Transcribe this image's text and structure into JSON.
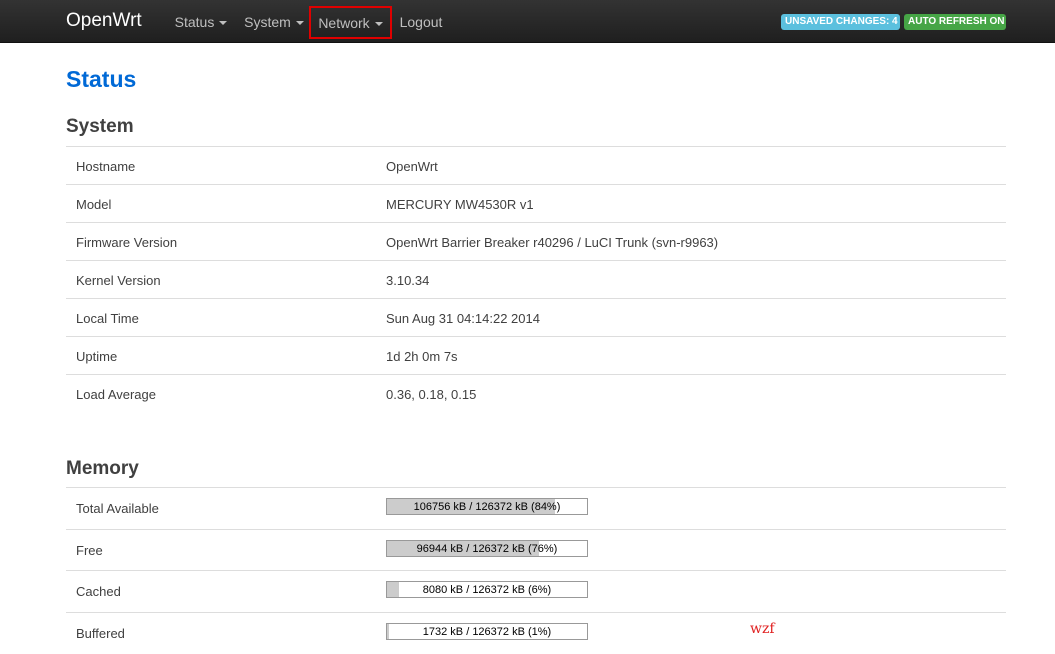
{
  "navbar": {
    "brand": "OpenWrt",
    "menus": [
      "Status",
      "System",
      "Network"
    ],
    "logout": "Logout",
    "badges": {
      "unsaved": "UNSAVED CHANGES: 4",
      "refresh": "AUTO REFRESH ON"
    }
  },
  "page_title": "Status",
  "system": {
    "title": "System",
    "rows": [
      {
        "label": "Hostname",
        "value": "OpenWrt"
      },
      {
        "label": "Model",
        "value": "MERCURY MW4530R v1"
      },
      {
        "label": "Firmware Version",
        "value": "OpenWrt Barrier Breaker r40296 / LuCI Trunk (svn-r9963)"
      },
      {
        "label": "Kernel Version",
        "value": "3.10.34"
      },
      {
        "label": "Local Time",
        "value": "Sun Aug 31 04:14:22 2014"
      },
      {
        "label": "Uptime",
        "value": "1d 2h 0m 7s"
      },
      {
        "label": "Load Average",
        "value": "0.36, 0.18, 0.15"
      }
    ]
  },
  "memory": {
    "title": "Memory",
    "rows": [
      {
        "label": "Total Available",
        "text": "106756 kB / 126372 kB (84%)",
        "percent": 84
      },
      {
        "label": "Free",
        "text": "96944 kB / 126372 kB (76%)",
        "percent": 76
      },
      {
        "label": "Cached",
        "text": "8080 kB / 126372 kB (6%)",
        "percent": 6
      },
      {
        "label": "Buffered",
        "text": "1732 kB / 126372 kB (1%)",
        "percent": 1
      }
    ]
  },
  "signature": "wzf",
  "colors": {
    "navbar_bg": "#222222",
    "title_blue": "#0069d6",
    "badge_info": "#5bc0de",
    "badge_success": "#46a546",
    "highlight_red": "#e00000",
    "bar_fill": "#cccccc"
  }
}
